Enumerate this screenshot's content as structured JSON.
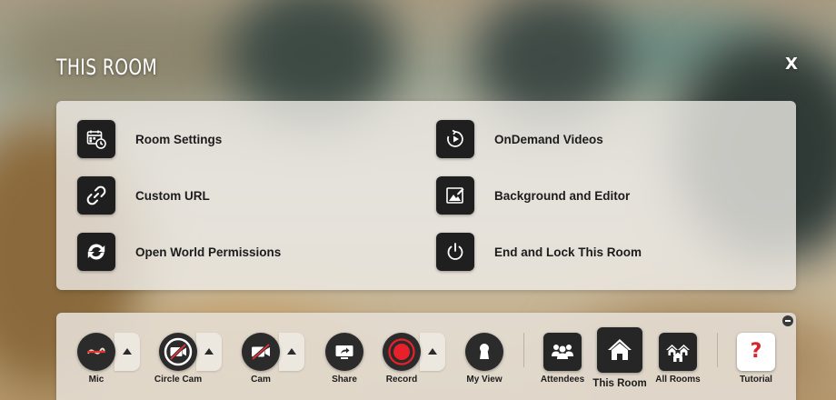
{
  "header": {
    "title": "THIS ROOM",
    "close_label": "X"
  },
  "menu": {
    "items": [
      {
        "label": "Room Settings",
        "icon": "calendar-clock-icon"
      },
      {
        "label": "Custom URL",
        "icon": "link-icon"
      },
      {
        "label": "Open World Permissions",
        "icon": "sync-icon"
      },
      {
        "label": "OnDemand Videos",
        "icon": "replay-play-icon"
      },
      {
        "label": "Background and Editor",
        "icon": "image-edit-icon"
      },
      {
        "label": "End and Lock This Room",
        "icon": "power-icon"
      }
    ]
  },
  "toolbar": {
    "mic": "Mic",
    "circle_cam": "Circle Cam",
    "cam": "Cam",
    "share": "Share",
    "record": "Record",
    "my_view": "My View",
    "attendees": "Attendees",
    "this_room": "This Room",
    "all_rooms": "All Rooms",
    "tutorial": "Tutorial",
    "tutorial_glyph": "?"
  },
  "colors": {
    "record_red": "#e8202a",
    "mic_strike_red": "#e63232",
    "tutorial_red": "#d9232d",
    "dark_button": "#262626"
  }
}
